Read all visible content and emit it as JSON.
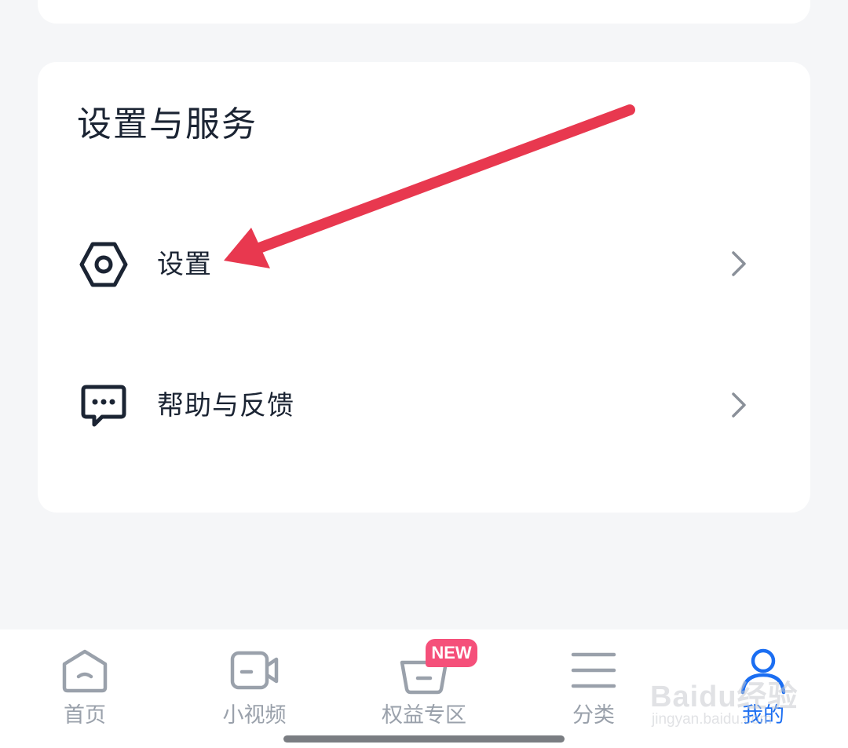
{
  "section": {
    "title": "设置与服务",
    "items": [
      {
        "label": "设置",
        "icon": "settings-hexagon-icon"
      },
      {
        "label": "帮助与反馈",
        "icon": "feedback-chat-icon"
      }
    ]
  },
  "annotation": {
    "type": "arrow",
    "color": "#e8384f"
  },
  "tabbar": {
    "tabs": [
      {
        "label": "首页",
        "icon": "home-icon",
        "active": false
      },
      {
        "label": "小视频",
        "icon": "video-camera-icon",
        "active": false
      },
      {
        "label": "权益专区",
        "icon": "basket-icon",
        "active": false,
        "badge": "NEW"
      },
      {
        "label": "分类",
        "icon": "menu-lines-icon",
        "active": false
      },
      {
        "label": "我的",
        "icon": "user-icon",
        "active": true
      }
    ]
  },
  "watermark": {
    "main": "Baidu经验",
    "sub": "jingyan.baidu.com"
  },
  "colors": {
    "accent": "#1b6ef2",
    "text": "#1b2433",
    "inactive": "#9aa1ab",
    "badge": "#f5507a"
  }
}
